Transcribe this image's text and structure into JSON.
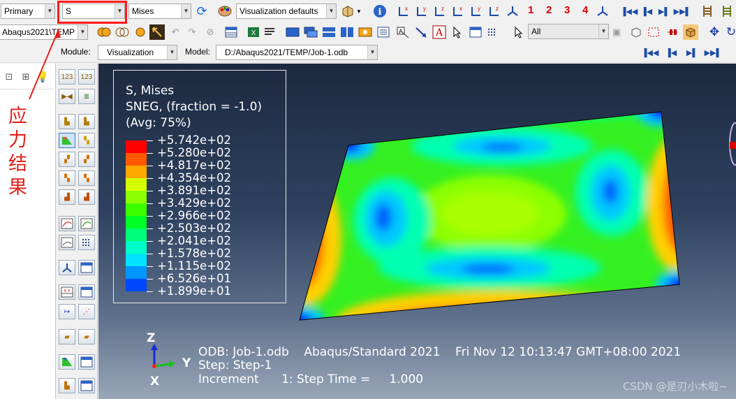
{
  "toolbar1": {
    "display_group": "Primary",
    "variable_field": "S",
    "invariant": "Mises",
    "visualization_defaults": "Visualization defaults",
    "step_numbers": [
      "1",
      "2",
      "3",
      "4"
    ]
  },
  "toolbar2": {
    "path": "Abaqus2021\\TEMP",
    "selection_filter": "All"
  },
  "context_bar": {
    "module_label": "Module:",
    "module_value": "Visualization",
    "model_label": "Model:",
    "model_value": "D:/Abaqus2021/TEMP/Job-1.odb"
  },
  "legend": {
    "title": "S, Mises",
    "line2": "SNEG, (fraction = -1.0)",
    "line3": "(Avg: 75%)",
    "values": [
      "+5.742e+02",
      "+5.280e+02",
      "+4.817e+02",
      "+4.354e+02",
      "+3.891e+02",
      "+3.429e+02",
      "+2.966e+02",
      "+2.503e+02",
      "+2.041e+02",
      "+1.578e+02",
      "+1.115e+02",
      "+6.526e+01",
      "+1.899e+01"
    ],
    "colors": [
      "#ff0000",
      "#ff5a00",
      "#ffa800",
      "#d6ff00",
      "#8cff00",
      "#3cff00",
      "#00ff28",
      "#00ff78",
      "#00ffc8",
      "#00e4ff",
      "#0096ff",
      "#0048ff",
      "#0000ff"
    ]
  },
  "info": {
    "odb_line": "ODB: Job-1.odb    Abaqus/Standard 2021    Fri Nov 12 10:13:47 GMT+08:00 2021",
    "step_line": "Step: Step-1",
    "increment_line": "Increment      1: Step Time =     1.000"
  },
  "triad": {
    "z": "Z",
    "y": "Y",
    "x": "X"
  },
  "annotation": {
    "text": "应力结果"
  },
  "watermark": "CSDN @是刃小木啦~"
}
